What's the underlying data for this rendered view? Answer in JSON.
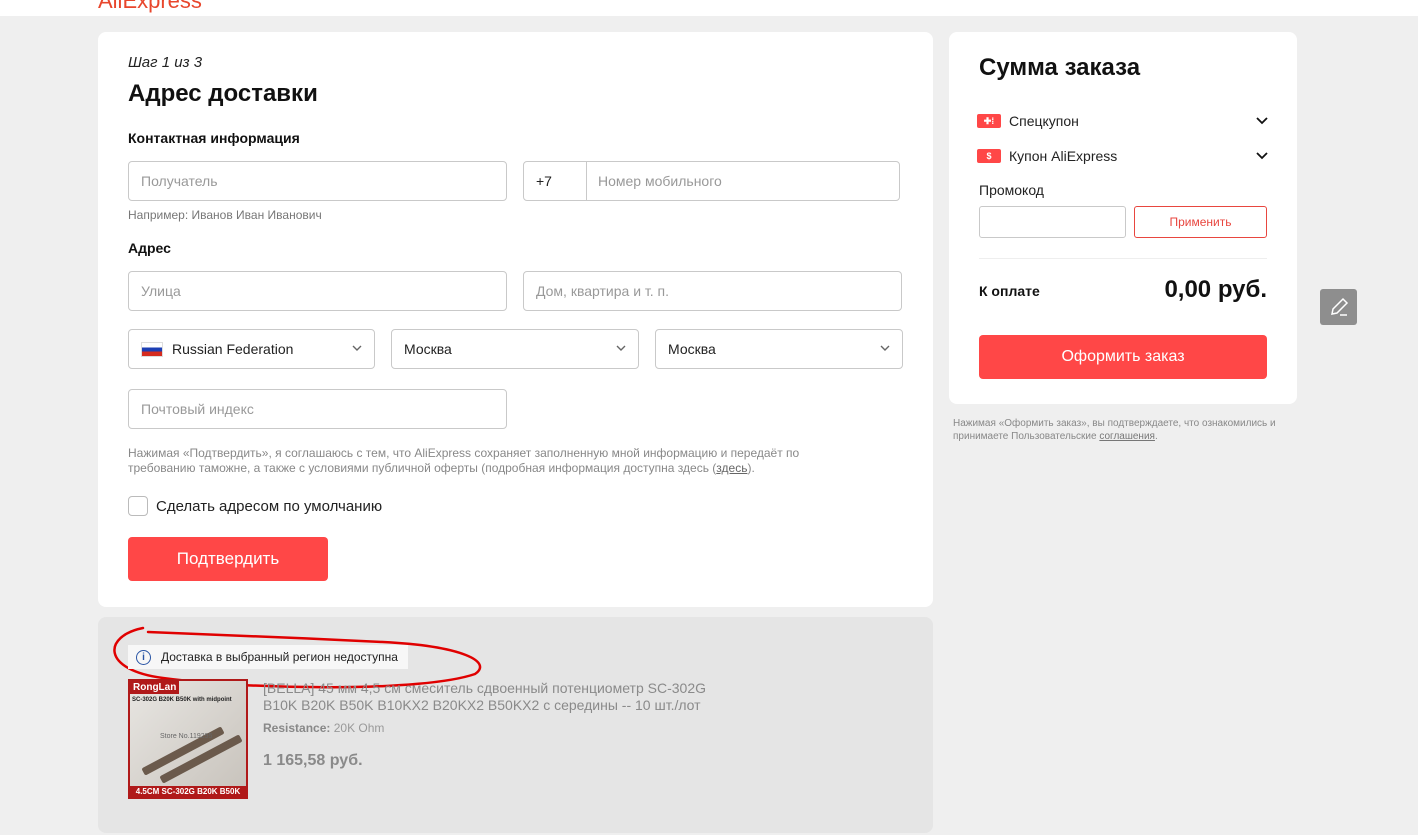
{
  "header": {
    "logo": "AliExpress"
  },
  "address_form": {
    "step": "Шаг 1 из 3",
    "title": "Адрес доставки",
    "contact_section": "Контактная информация",
    "recipient_placeholder": "Получатель",
    "phone_code": "+7",
    "phone_placeholder": "Номер мобильного",
    "recipient_hint": "Например: Иванов Иван Иванович",
    "address_section": "Адрес",
    "street_placeholder": "Улица",
    "house_placeholder": "Дом, квартира и т. п.",
    "country": "Russian Federation",
    "region": "Москва",
    "city": "Москва",
    "zip_placeholder": "Почтовый индекс",
    "legal_text": "Нажимая «Подтвердить», я соглашаюсь с тем, что AliExpress сохраняет заполненную мной информацию и передаёт по требованию таможне, а также с условиями публичной оферты (подробная информация доступна здесь (",
    "legal_link": "здесь",
    "legal_tail": ").",
    "default_checkbox_label": "Сделать адресом по умолчанию",
    "confirm_button": "Подтвердить"
  },
  "product": {
    "notice": "Доставка в выбранный регион недоступна",
    "title": "[BELLA] 45 мм 4,5 см смеситель сдвоенный потенциометр SC-302G B10K B20K B50K B10KX2 B20KX2 B50KX2 с середины -- 10 шт./лот",
    "attr_label": "Resistance:",
    "attr_value": "20K Ohm",
    "price": "1 165,58 руб.",
    "image_brand": "RongLan",
    "image_tagline": "SC-302G B20K B50K with midpoint",
    "image_store": "Store No.119295",
    "image_bottom": "4.5CM SC-302G B20K B50K"
  },
  "summary": {
    "title": "Сумма заказа",
    "coupon1": "Спецкупон",
    "coupon2": "Купон AliExpress",
    "promo_label": "Промокод",
    "promo_button": "Применить",
    "topay_label": "К оплате",
    "topay_value": "0,00 руб.",
    "order_button": "Оформить заказ",
    "agree_text": "Нажимая «Оформить заказ», вы подтверждаете, что ознакомились и принимаете Пользовательские ",
    "agree_link": "соглашения",
    "agree_tail": "."
  },
  "colors": {
    "accent": "#ff4747",
    "background": "#efefef",
    "annotation": "#e00000"
  },
  "icons": [
    "chevron-down-icon",
    "info-icon",
    "coupon-icon",
    "dollar-coupon-icon",
    "pencil-icon",
    "flag-ru-icon"
  ]
}
